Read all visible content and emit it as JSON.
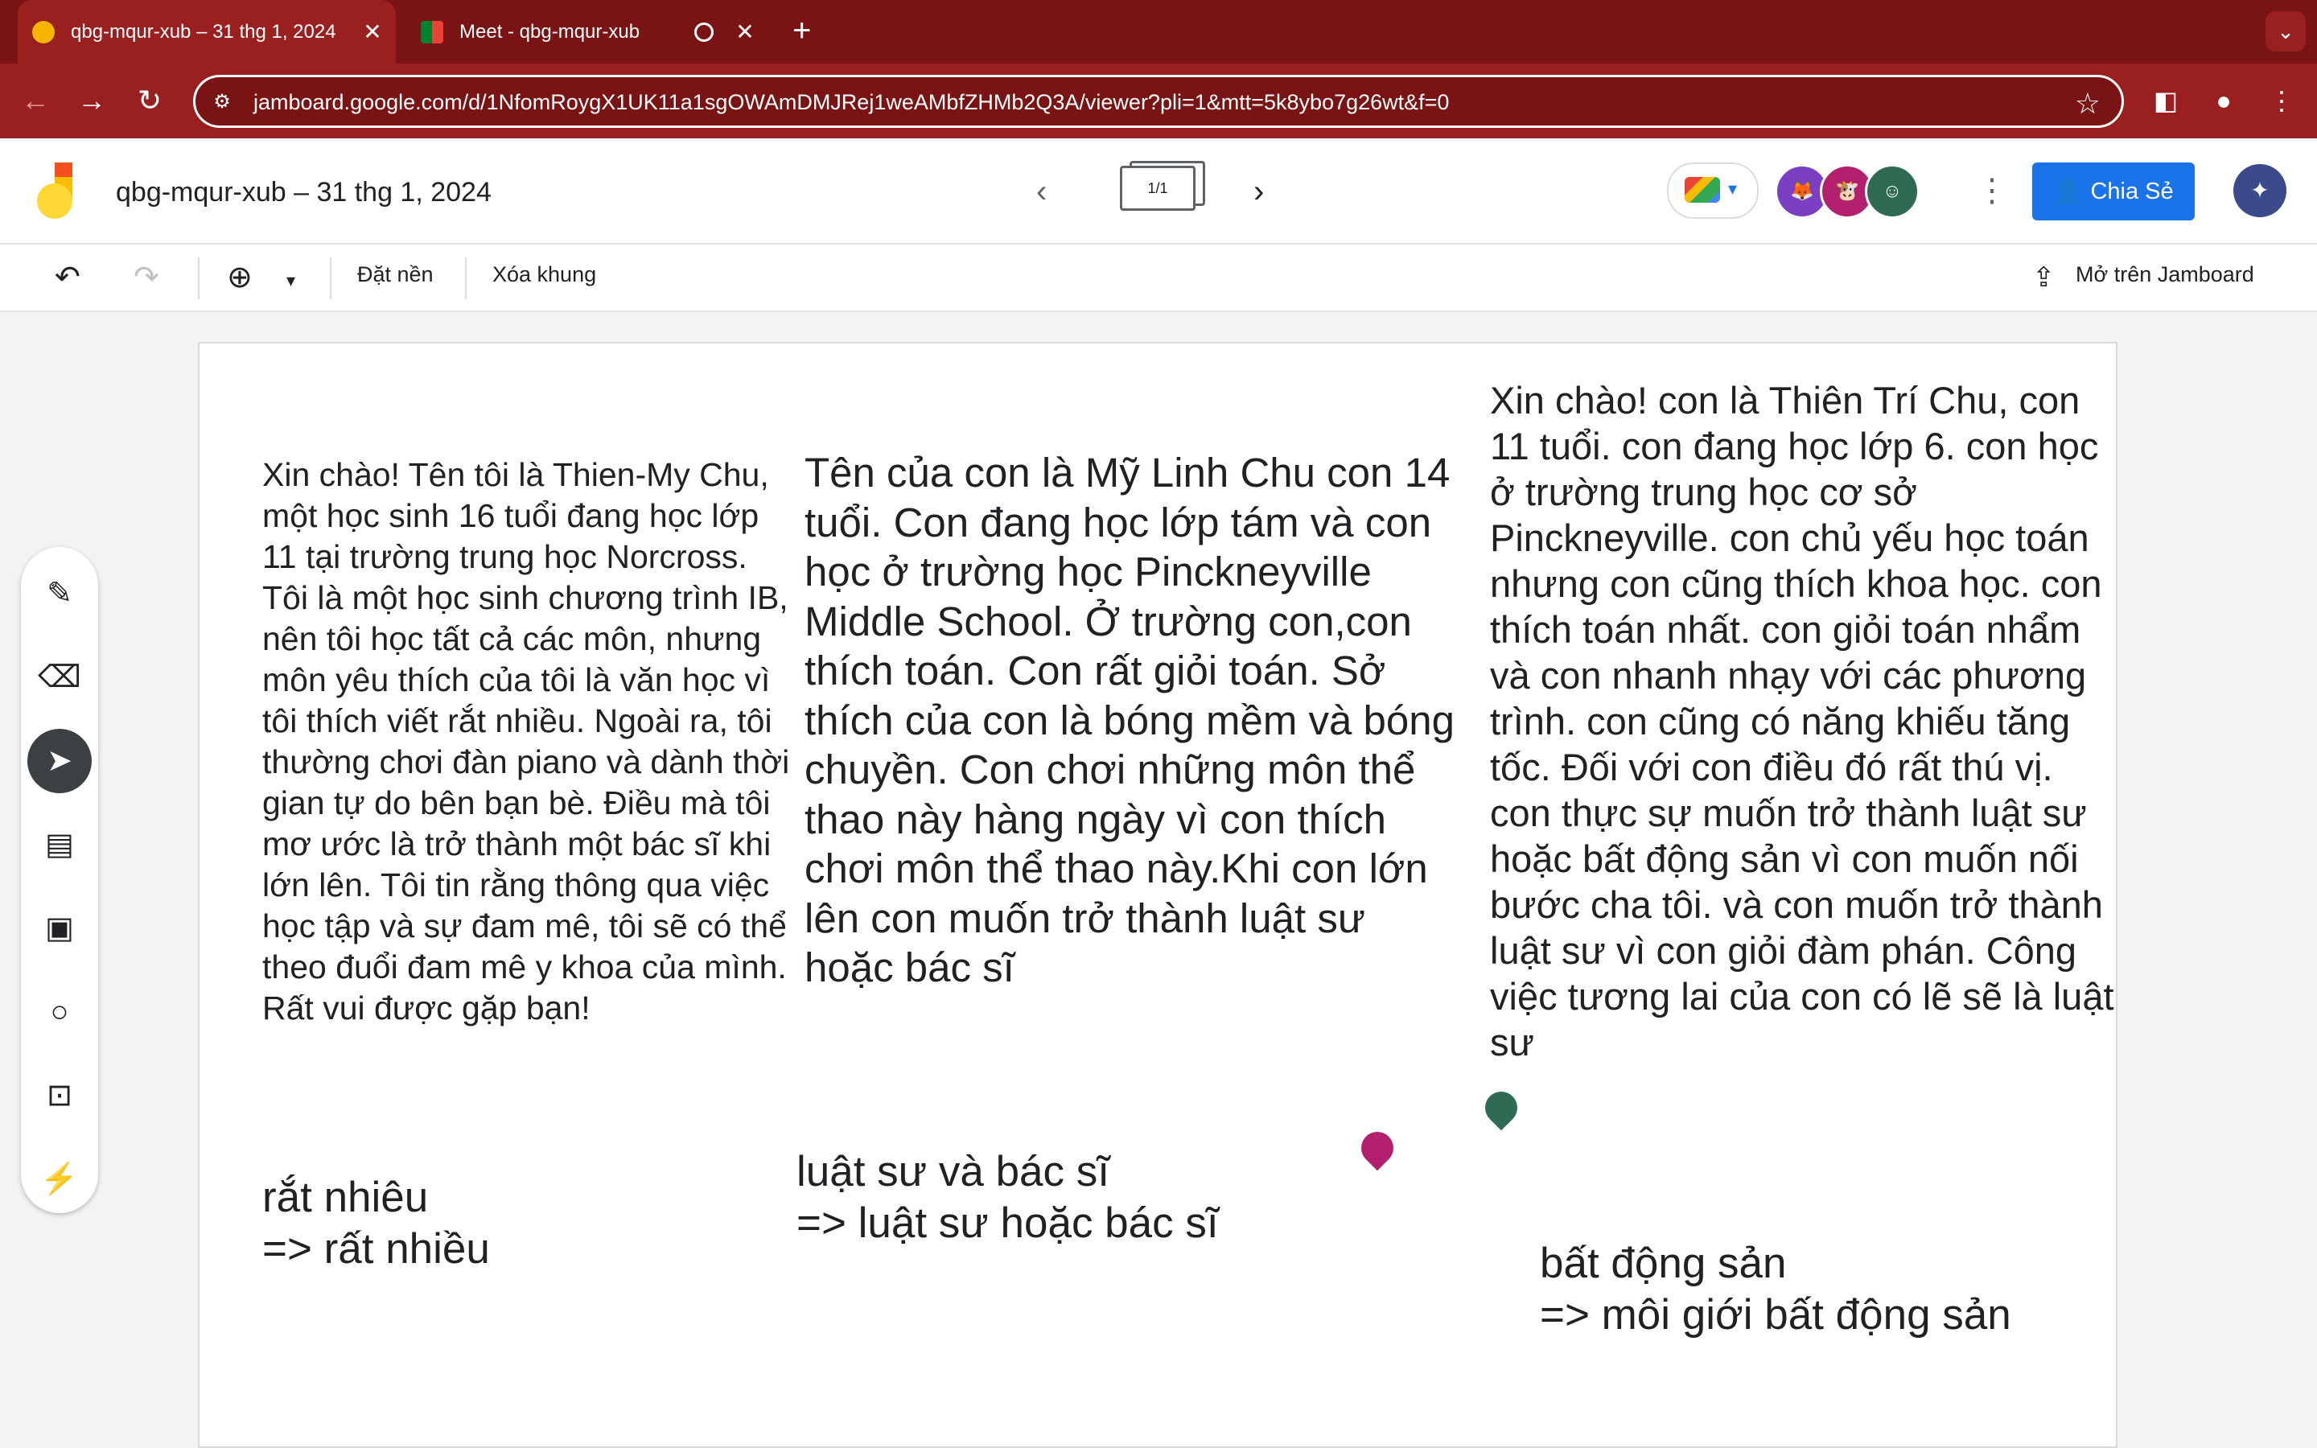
{
  "browser": {
    "tabs": [
      {
        "title": "qbg-mqur-xub – 31 thg 1, 2024",
        "active": true,
        "icon": "jamboard-icon"
      },
      {
        "title": "Meet - qbg-mqur-xub",
        "active": false,
        "icon": "meet-icon",
        "recording": true
      }
    ],
    "url": "jamboard.google.com/d/1NfomRoygX1UK11a1sgOWAmDMJRej1weAMbfZHMb2Q3A/viewer?pli=1&mtt=5k8ybo7g26wt&f=0",
    "tab_color": "#7a1414"
  },
  "app": {
    "title": "qbg-mqur-xub – 31 thg 1, 2024",
    "frame_indicator": "1/1",
    "share_label": "Chia Sẻ",
    "accent": "#1a73e8"
  },
  "toolbar": {
    "set_background": "Đặt nền",
    "clear_frame": "Xóa khung",
    "open_in_jamboard": "Mở trên Jamboard"
  },
  "board": {
    "text1": "Xin chào! Tên tôi là Thien-My Chu, một học sinh 16 tuổi đang học lớp 11 tại trường trung học Norcross. Tôi là một học sinh chương trình IB, nên tôi học tất cả các môn, nhưng môn yêu thích của tôi là văn học vì tôi thích viết rắt nhiều. Ngoài ra, tôi thường chơi đàn piano và dành thời gian tự do bên bạn bè. Điều mà tôi mơ ước là trở thành một bác sĩ khi lớn lên. Tôi tin rằng thông qua việc học tập và sự đam mê, tôi sẽ có thể theo đuổi đam mê y khoa của mình. Rất vui được gặp bạn!",
    "text2": "Tên của con là Mỹ Linh Chu con 14 tuổi. Con đang học lớp tám và con học ở trường  học  Pinckneyville Middle School. Ở trường con,con thích toán. Con rất giỏi toán. Sở thích của con là bóng mềm và bóng chuyền. Con chơi những môn thể thao này hàng ngày vì con thích chơi môn thể thao này.Khi con lớn lên con muốn trở thành luật sư hoặc bác sĩ",
    "text3": "Xin chào! con là Thiên Trí Chu, con 11 tuổi. con đang học lớp 6. con học ở trường trung học cơ sở Pinckneyville. con chủ yếu học toán nhưng con cũng thích khoa học. con thích toán nhất. con giỏi toán nhẩm và con nhanh nhạy với các phương trình. con cũng có năng khiếu tăng tốc. Đối với con điều đó rất thú vị. con thực sự muốn trở thành luật sư hoặc bất động sản vì con muốn nối bước cha tôi. và con muốn trở thành luật sư vì con giỏi đàm phán. Công việc tương lai của con có lẽ sẽ là luật sư",
    "note1_line1": "rắt nhiêu",
    "note1_line2": "=> rất nhiều",
    "note2_line1": "luật sư và bác sĩ",
    "note2_line2": "=> luật sư hoặc bác sĩ",
    "note3_line1": "bất động sản",
    "note3_line2": "=> môi giới bất động sản"
  }
}
